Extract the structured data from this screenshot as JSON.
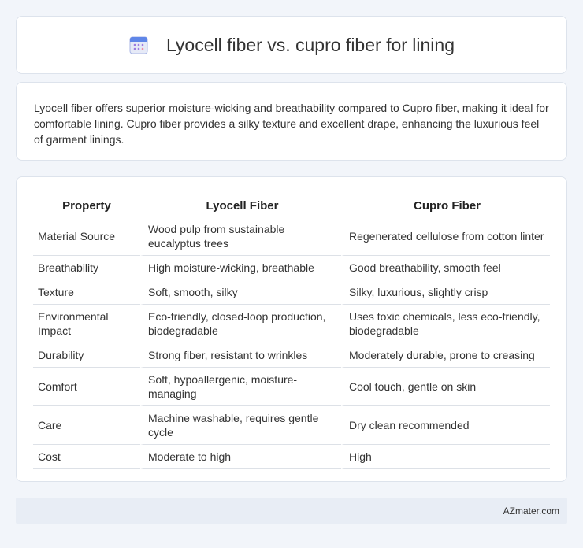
{
  "header": {
    "title": "Lyocell fiber vs. cupro fiber for lining",
    "icon": "calendar-icon"
  },
  "summary": "Lyocell fiber offers superior moisture-wicking and breathability compared to Cupro fiber, making it ideal for comfortable lining. Cupro fiber provides a silky texture and excellent drape, enhancing the luxurious feel of garment linings.",
  "table": {
    "headers": [
      "Property",
      "Lyocell Fiber",
      "Cupro Fiber"
    ],
    "rows": [
      [
        "Material Source",
        "Wood pulp from sustainable eucalyptus trees",
        "Regenerated cellulose from cotton linter"
      ],
      [
        "Breathability",
        "High moisture-wicking, breathable",
        "Good breathability, smooth feel"
      ],
      [
        "Texture",
        "Soft, smooth, silky",
        "Silky, luxurious, slightly crisp"
      ],
      [
        "Environmental Impact",
        "Eco-friendly, closed-loop production, biodegradable",
        "Uses toxic chemicals, less eco-friendly, biodegradable"
      ],
      [
        "Durability",
        "Strong fiber, resistant to wrinkles",
        "Moderately durable, prone to creasing"
      ],
      [
        "Comfort",
        "Soft, hypoallergenic, moisture-managing",
        "Cool touch, gentle on skin"
      ],
      [
        "Care",
        "Machine washable, requires gentle cycle",
        "Dry clean recommended"
      ],
      [
        "Cost",
        "Moderate to high",
        "High"
      ]
    ]
  },
  "footer": {
    "site": "AZmater.com"
  }
}
